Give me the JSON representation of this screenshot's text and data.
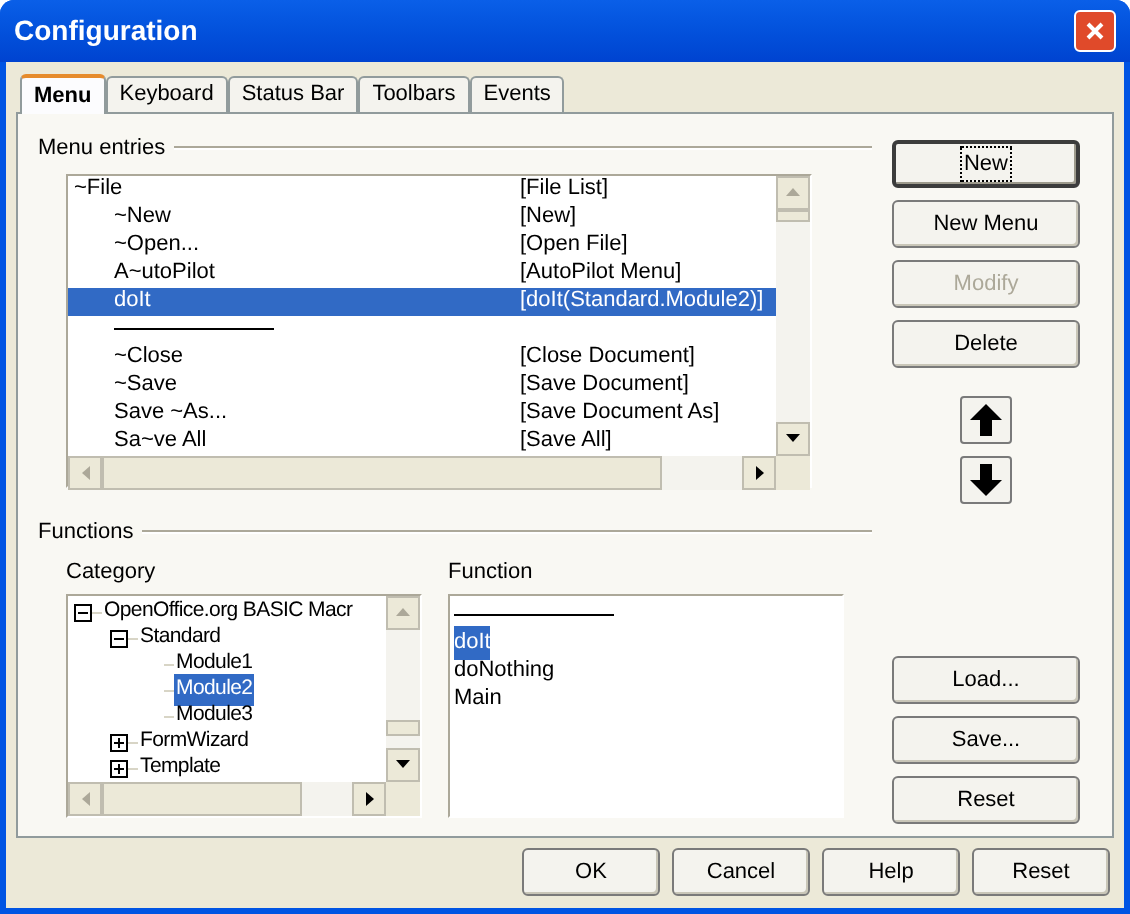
{
  "window": {
    "title": "Configuration"
  },
  "tabs": [
    {
      "label": "Menu",
      "selected": true
    },
    {
      "label": "Keyboard",
      "selected": false
    },
    {
      "label": "Status Bar",
      "selected": false
    },
    {
      "label": "Toolbars",
      "selected": false
    },
    {
      "label": "Events",
      "selected": false
    }
  ],
  "menu_entries": {
    "label": "Menu entries",
    "rows": [
      {
        "kind": "entry",
        "name": "~File",
        "command": "[File List]",
        "selected": false,
        "children": [
          {
            "kind": "entry",
            "name": "~New",
            "command": "[New]",
            "selected": false
          },
          {
            "kind": "entry",
            "name": "~Open...",
            "command": "[Open File]",
            "selected": false
          },
          {
            "kind": "entry",
            "name": "A~utoPilot",
            "command": "[AutoPilot Menu]",
            "selected": false
          },
          {
            "kind": "entry",
            "name": "doIt",
            "command": "[doIt(Standard.Module2)]",
            "selected": true
          },
          {
            "kind": "separator"
          },
          {
            "kind": "entry",
            "name": "~Close",
            "command": "[Close Document]",
            "selected": false
          },
          {
            "kind": "entry",
            "name": "~Save",
            "command": "[Save Document]",
            "selected": false
          },
          {
            "kind": "entry",
            "name": "Save ~As...",
            "command": "[Save Document As]",
            "selected": false
          },
          {
            "kind": "entry",
            "name": "Sa~ve All",
            "command": "[Save All]",
            "selected": false
          }
        ]
      }
    ]
  },
  "functions": {
    "label": "Functions",
    "category": {
      "label": "Category",
      "tree": [
        {
          "label": "OpenOffice.org BASIC Macr",
          "expanded": true,
          "selected": false,
          "children": [
            {
              "label": "Standard",
              "expanded": true,
              "selected": false,
              "children": [
                {
                  "label": "Module1",
                  "selected": false
                },
                {
                  "label": "Module2",
                  "selected": true
                },
                {
                  "label": "Module3",
                  "selected": false
                }
              ]
            },
            {
              "label": "FormWizard",
              "expanded": false,
              "selected": false
            },
            {
              "label": "Template",
              "expanded": false,
              "selected": false
            }
          ]
        }
      ]
    },
    "function": {
      "label": "Function",
      "items": [
        {
          "kind": "separator"
        },
        {
          "kind": "item",
          "label": "doIt",
          "selected": true
        },
        {
          "kind": "item",
          "label": "doNothing",
          "selected": false
        },
        {
          "kind": "item",
          "label": "Main",
          "selected": false
        }
      ]
    }
  },
  "side_buttons": [
    {
      "label": "New",
      "disabled": false,
      "focused": true
    },
    {
      "label": "New Menu",
      "disabled": false,
      "focused": false
    },
    {
      "label": "Modify",
      "disabled": true,
      "focused": false
    },
    {
      "label": "Delete",
      "disabled": false,
      "focused": false
    }
  ],
  "file_buttons": [
    {
      "label": "Load..."
    },
    {
      "label": "Save..."
    },
    {
      "label": "Reset"
    }
  ],
  "footer_buttons": [
    {
      "label": "OK"
    },
    {
      "label": "Cancel"
    },
    {
      "label": "Help"
    },
    {
      "label": "Reset"
    }
  ]
}
